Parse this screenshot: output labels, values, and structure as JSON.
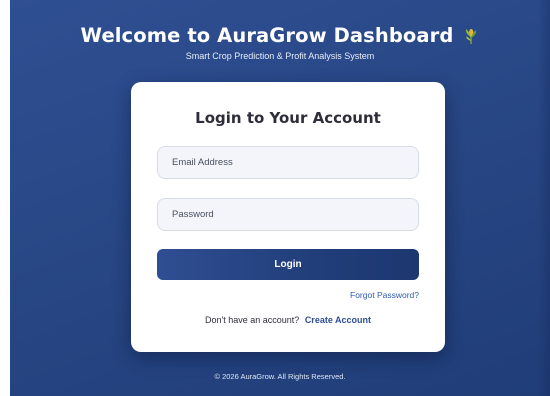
{
  "header": {
    "title": "Welcome to AuraGrow Dashboard",
    "subtitle": "Smart Crop Prediction & Profit Analysis System",
    "icon": "plant-icon"
  },
  "login_card": {
    "title": "Login to Your Account",
    "email_placeholder": "Email Address",
    "password_placeholder": "Password",
    "login_label": "Login",
    "forgot_label": "Forgot Password?",
    "signup_prompt": "Don't have an account?",
    "create_account_label": "Create Account"
  },
  "footer": {
    "text": "© 2026 AuraGrow. All Rights Reserved."
  },
  "colors": {
    "background": "#284785",
    "button": "#213e7a",
    "link": "#2d5bb0",
    "card": "#ffffff"
  }
}
